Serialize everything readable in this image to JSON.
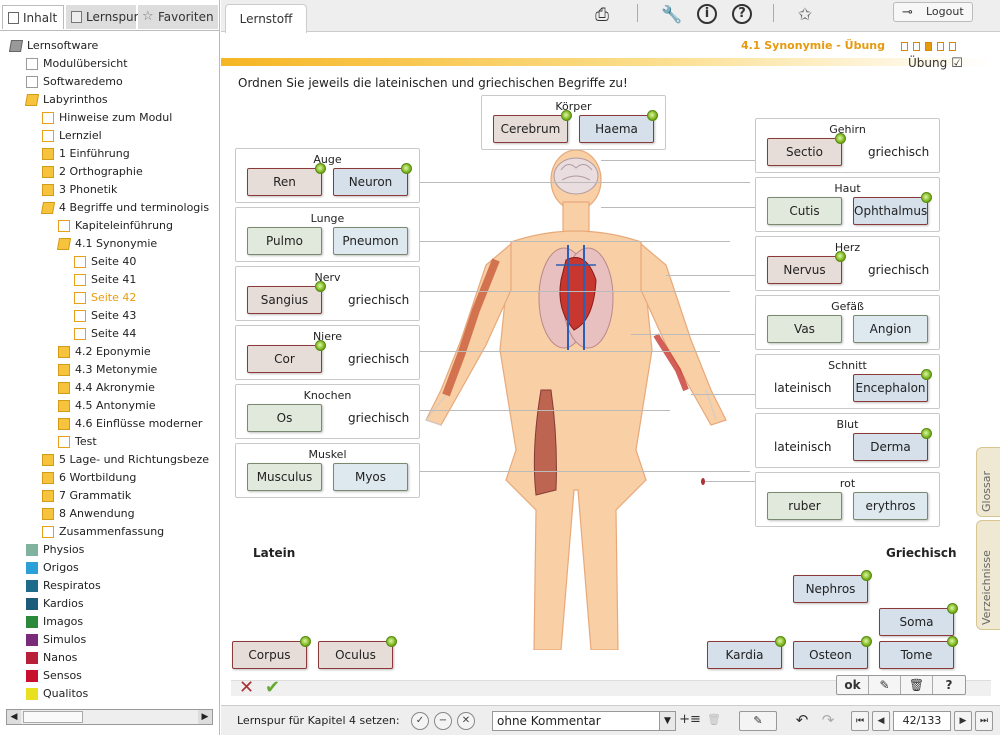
{
  "left_panel": {
    "tabs": [
      {
        "label": "Inhalt",
        "icon": "document-icon"
      },
      {
        "label": "Lernspur",
        "icon": "book-icon"
      },
      {
        "label": "Favoriten",
        "icon": "star-icon"
      }
    ],
    "tree": [
      {
        "label": "Lernsoftware",
        "indent": 0,
        "icon": "folder-open",
        "selected": false
      },
      {
        "label": "Modulübersicht",
        "indent": 1,
        "icon": "page",
        "selected": false
      },
      {
        "label": "Softwaredemo",
        "indent": 1,
        "icon": "page",
        "selected": false
      },
      {
        "label": "Labyrinthos",
        "indent": 1,
        "icon": "folder-open",
        "selected": false
      },
      {
        "label": "Hinweise zum Modul",
        "indent": 2,
        "icon": "page-orange",
        "selected": false
      },
      {
        "label": "Lernziel",
        "indent": 2,
        "icon": "page-orange",
        "selected": false
      },
      {
        "label": "1 Einführung",
        "indent": 2,
        "icon": "folder",
        "selected": false
      },
      {
        "label": "2 Orthographie",
        "indent": 2,
        "icon": "folder",
        "selected": false
      },
      {
        "label": "3 Phonetik",
        "indent": 2,
        "icon": "folder",
        "selected": false
      },
      {
        "label": "4 Begriffe und terminologis",
        "indent": 2,
        "icon": "folder-open",
        "selected": false
      },
      {
        "label": "Kapiteleinführung",
        "indent": 3,
        "icon": "page-orange",
        "selected": false
      },
      {
        "label": "4.1 Synonymie",
        "indent": 3,
        "icon": "folder-open",
        "selected": false
      },
      {
        "label": "Seite 40",
        "indent": 4,
        "icon": "page-orange",
        "selected": false
      },
      {
        "label": "Seite 41",
        "indent": 4,
        "icon": "page-orange",
        "selected": false
      },
      {
        "label": "Seite 42",
        "indent": 4,
        "icon": "page-orange",
        "selected": true
      },
      {
        "label": "Seite 43",
        "indent": 4,
        "icon": "page-orange",
        "selected": false
      },
      {
        "label": "Seite 44",
        "indent": 4,
        "icon": "page-orange",
        "selected": false
      },
      {
        "label": "4.2 Eponymie",
        "indent": 3,
        "icon": "folder",
        "selected": false
      },
      {
        "label": "4.3 Metonymie",
        "indent": 3,
        "icon": "folder",
        "selected": false
      },
      {
        "label": "4.4 Akronymie",
        "indent": 3,
        "icon": "folder",
        "selected": false
      },
      {
        "label": "4.5 Antonymie",
        "indent": 3,
        "icon": "folder",
        "selected": false
      },
      {
        "label": "4.6 Einflüsse moderner",
        "indent": 3,
        "icon": "folder",
        "selected": false
      },
      {
        "label": "Test",
        "indent": 3,
        "icon": "page-orange",
        "selected": false
      },
      {
        "label": "5 Lage- und Richtungsbeze",
        "indent": 2,
        "icon": "folder",
        "selected": false
      },
      {
        "label": "6 Wortbildung",
        "indent": 2,
        "icon": "folder",
        "selected": false
      },
      {
        "label": "7 Grammatik",
        "indent": 2,
        "icon": "folder",
        "selected": false
      },
      {
        "label": "8 Anwendung",
        "indent": 2,
        "icon": "folder",
        "selected": false
      },
      {
        "label": "Zusammenfassung",
        "indent": 2,
        "icon": "page-orange",
        "selected": false
      },
      {
        "label": "Physios",
        "indent": 1,
        "icon": "module",
        "color": "#7fb3a0",
        "selected": false
      },
      {
        "label": "Origos",
        "indent": 1,
        "icon": "module",
        "color": "#2a9fd8",
        "selected": false
      },
      {
        "label": "Respiratos",
        "indent": 1,
        "icon": "module",
        "color": "#1f6b8a",
        "selected": false
      },
      {
        "label": "Kardios",
        "indent": 1,
        "icon": "module",
        "color": "#1d5b7a",
        "selected": false
      },
      {
        "label": "Imagos",
        "indent": 1,
        "icon": "module",
        "color": "#2a8a3a",
        "selected": false
      },
      {
        "label": "Simulos",
        "indent": 1,
        "icon": "module",
        "color": "#7a2a7a",
        "selected": false
      },
      {
        "label": "Nanos",
        "indent": 1,
        "icon": "module",
        "color": "#b8203a",
        "selected": false
      },
      {
        "label": "Sensos",
        "indent": 1,
        "icon": "module",
        "color": "#c8102e",
        "selected": false
      },
      {
        "label": "Qualitos",
        "indent": 1,
        "icon": "module",
        "color": "#e8e020",
        "selected": false
      }
    ]
  },
  "topbar": {
    "tab_label": "Lernstoff",
    "icons": [
      "printer-icon",
      "wrench-icon",
      "info-icon",
      "help-icon",
      "star-add-icon"
    ],
    "logout_label": "Logout"
  },
  "content": {
    "section_title": "4.1 Synonymie - Übung",
    "ubung_label": "Übung",
    "instruction": "Ordnen Sie jeweils die lateinischen und griechischen Begriffe zu!",
    "caption_latein": "Latein",
    "caption_griechisch": "Griechisch",
    "boxes": [
      {
        "label": "Körper",
        "left": [
          {
            "text": "Cerebrum",
            "type": "lat"
          }
        ],
        "right": [
          {
            "text": "Haema",
            "type": "gre"
          }
        ]
      },
      {
        "label": "Auge",
        "left": [
          {
            "text": "Ren",
            "type": "lat"
          }
        ],
        "right": [
          {
            "text": "Neuron",
            "type": "gre"
          }
        ]
      },
      {
        "label": "Lunge",
        "left": [
          {
            "text": "Pulmo",
            "type": "lat ok"
          }
        ],
        "right": [
          {
            "text": "Pneumon",
            "type": "gre ok"
          }
        ]
      },
      {
        "label": "Nerv",
        "left": [
          {
            "text": "Sangius",
            "type": "lat"
          }
        ],
        "right_text": "griechisch"
      },
      {
        "label": "Niere",
        "left": [
          {
            "text": "Cor",
            "type": "lat"
          }
        ],
        "right_text": "griechisch"
      },
      {
        "label": "Knochen",
        "left": [
          {
            "text": "Os",
            "type": "lat ok"
          }
        ],
        "right_text": "griechisch"
      },
      {
        "label": "Muskel",
        "left": [
          {
            "text": "Musculus",
            "type": "lat ok"
          }
        ],
        "right": [
          {
            "text": "Myos",
            "type": "gre ok"
          }
        ]
      },
      {
        "label": "Gehirn",
        "left": [
          {
            "text": "Sectio",
            "type": "lat"
          }
        ],
        "right_text": "griechisch"
      },
      {
        "label": "Haut",
        "left": [
          {
            "text": "Cutis",
            "type": "lat ok"
          }
        ],
        "right": [
          {
            "text": "Ophthalmus",
            "type": "gre"
          }
        ]
      },
      {
        "label": "Herz",
        "left": [
          {
            "text": "Nervus",
            "type": "lat"
          }
        ],
        "right_text": "griechisch"
      },
      {
        "label": "Gefäß",
        "left": [
          {
            "text": "Vas",
            "type": "lat ok"
          }
        ],
        "right": [
          {
            "text": "Angion",
            "type": "gre ok"
          }
        ]
      },
      {
        "label": "Schnitt",
        "left_text": "lateinisch",
        "right": [
          {
            "text": "Encephalon",
            "type": "gre"
          }
        ]
      },
      {
        "label": "Blut",
        "left_text": "lateinisch",
        "right": [
          {
            "text": "Derma",
            "type": "gre"
          }
        ]
      },
      {
        "label": "rot",
        "left": [
          {
            "text": "ruber",
            "type": "lat ok"
          }
        ],
        "right": [
          {
            "text": "erythros",
            "type": "gre ok"
          }
        ]
      }
    ],
    "loose_tiles": [
      {
        "text": "Nephros",
        "type": "gre"
      },
      {
        "text": "Soma",
        "type": "gre"
      },
      {
        "text": "Corpus",
        "type": "lat"
      },
      {
        "text": "Oculus",
        "type": "lat"
      },
      {
        "text": "Kardia",
        "type": "gre"
      },
      {
        "text": "Osteon",
        "type": "gre"
      },
      {
        "text": "Tome",
        "type": "gre"
      }
    ],
    "buttons": {
      "ok": "ok",
      "edit_icon": "edit-icon",
      "trash_icon": "trash-icon",
      "help": "?"
    }
  },
  "side_tabs": [
    {
      "label": "Glossar"
    },
    {
      "label": "Verzeichnisse"
    }
  ],
  "footer": {
    "lernspur_label": "Lernspur für Kapitel 4 setzen:",
    "comment_value": "ohne Kommentar",
    "page_counter": "42/133"
  }
}
